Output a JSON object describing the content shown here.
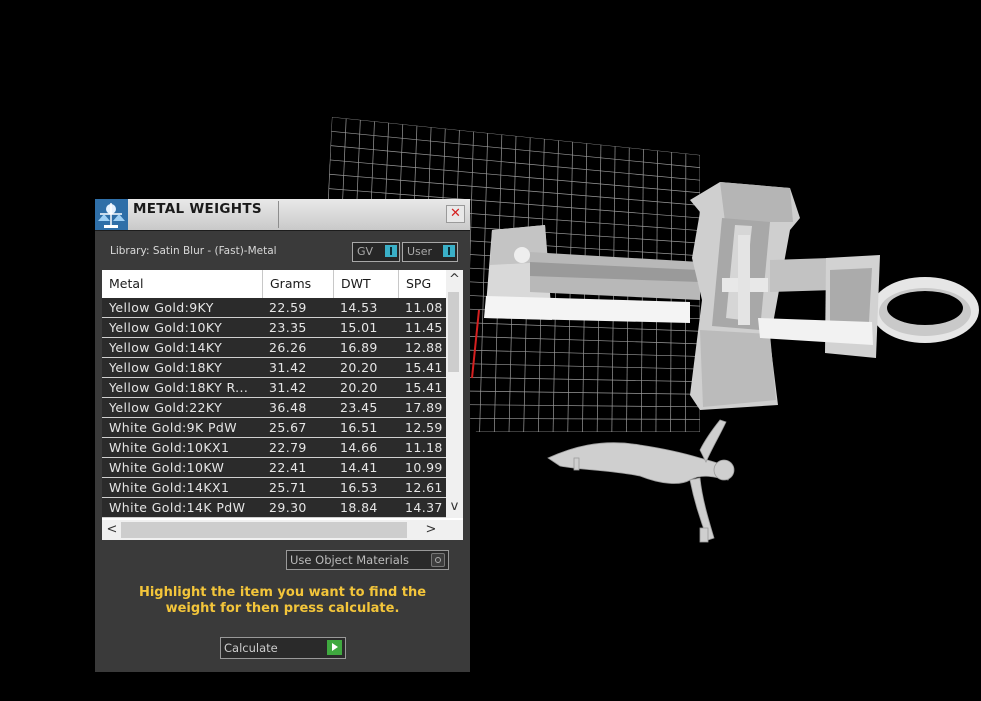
{
  "dialog": {
    "title": "METAL WEIGHTS",
    "close_label": "✕",
    "library_label": "Library: Satin Blur - (Fast)-Metal",
    "gv_label": "GV",
    "user_label": "User"
  },
  "table": {
    "columns": [
      "Metal",
      "Grams",
      "DWT",
      "SPG"
    ],
    "rows": [
      [
        "Yellow Gold:9KY",
        "22.59",
        "14.53",
        "11.08"
      ],
      [
        "Yellow Gold:10KY",
        "23.35",
        "15.01",
        "11.45"
      ],
      [
        "Yellow Gold:14KY",
        "26.26",
        "16.89",
        "12.88"
      ],
      [
        "Yellow Gold:18KY",
        "31.42",
        "20.20",
        "15.41"
      ],
      [
        "Yellow Gold:18KY R...",
        "31.42",
        "20.20",
        "15.41"
      ],
      [
        "Yellow Gold:22KY",
        "36.48",
        "23.45",
        "17.89"
      ],
      [
        "White Gold:9K PdW",
        "25.67",
        "16.51",
        "12.59"
      ],
      [
        "White Gold:10KX1",
        "22.79",
        "14.66",
        "11.18"
      ],
      [
        "White Gold:10KW",
        "22.41",
        "14.41",
        "10.99"
      ],
      [
        "White Gold:14KX1",
        "25.71",
        "16.53",
        "12.61"
      ],
      [
        "White Gold:14K PdW",
        "29.30",
        "18.84",
        "14.37"
      ]
    ]
  },
  "scroll": {
    "up": "^",
    "down": "v",
    "left": "<",
    "right": ">"
  },
  "use_object_materials_label": "Use Object Materials",
  "hint_text": "Highlight the item you want to find the weight for then press calculate.",
  "calculate_label": "Calculate",
  "colors": {
    "background": "#000000",
    "panel": "#3a3a3a",
    "hint": "#f3c53a",
    "toggle_accent": "#3ab0c8",
    "calculate_accent": "#3fa93f",
    "axis_red": "#d42020"
  },
  "icons": [
    "balance-scale-icon",
    "close-icon",
    "toggle-icon",
    "radio-icon",
    "play-icon",
    "chevron-up-icon",
    "chevron-down-icon",
    "chevron-left-icon",
    "chevron-right-icon"
  ]
}
